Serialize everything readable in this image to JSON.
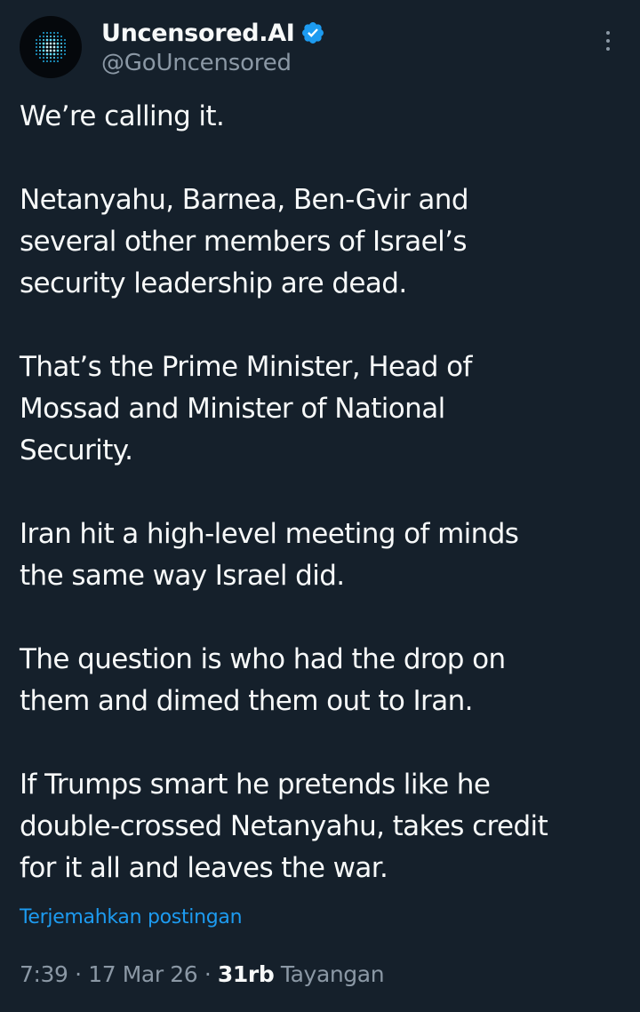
{
  "author": {
    "display_name": "Uncensored.AI",
    "handle": "@GoUncensored",
    "avatar_icon": "dotted-sphere-logo",
    "verified_icon": "verified-badge-icon"
  },
  "more_icon": "more-vertical-icon",
  "tweet": {
    "paragraphs": [
      {
        "lines": [
          "We’re calling it."
        ]
      },
      {
        "lines": [
          "Netanyahu, Barnea, Ben-Gvir and",
          "several other members of Israel’s",
          "security leadership are dead."
        ]
      },
      {
        "lines": [
          "That’s the Prime Minister, Head of",
          "Mossad and Minister of National",
          "Security."
        ]
      },
      {
        "lines": [
          "Iran hit a high-level meeting of minds",
          "the same way Israel did."
        ]
      },
      {
        "lines": [
          "The question is who had the drop on",
          "them and dimed them out to Iran."
        ]
      },
      {
        "lines": [
          "If Trumps smart he pretends like he",
          "double-crossed Netanyahu, takes credit",
          "for it all and leaves the war."
        ]
      }
    ]
  },
  "translate_label": "Terjemahkan postingan",
  "meta": {
    "time": "7:39",
    "separator": "·",
    "date": "17 Mar 26",
    "views_count": "31rb",
    "views_label": "Tayangan"
  },
  "colors": {
    "background": "#15202b",
    "text": "#f7f9f9",
    "secondary": "#8b98a5",
    "accent": "#1d9bf0"
  }
}
